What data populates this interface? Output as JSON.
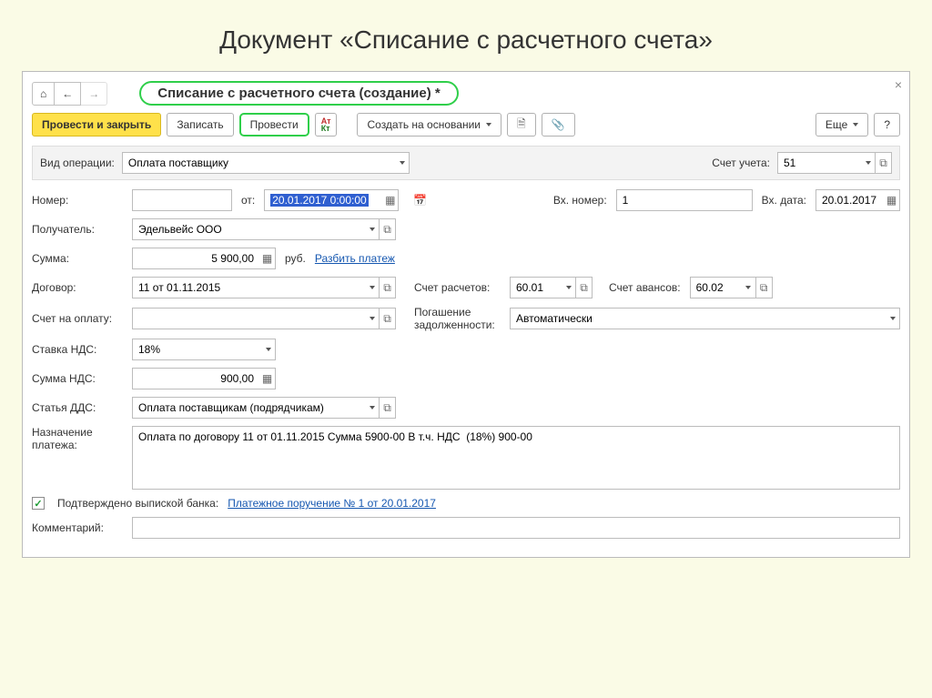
{
  "page_heading": "Документ «Списание с расчетного счета»",
  "doc_title": "Списание с расчетного счета (создание) *",
  "toolbar": {
    "post_close": "Провести и закрыть",
    "save": "Записать",
    "post": "Провести",
    "create_based": "Создать на основании",
    "more": "Еще",
    "help": "?"
  },
  "operation": {
    "label": "Вид операции:",
    "value": "Оплата поставщику",
    "account_label": "Счет учета:",
    "account_value": "51"
  },
  "number": {
    "label": "Номер:",
    "value": "",
    "from_label": "от:",
    "date": "20.01.2017  0:00:00"
  },
  "incoming": {
    "num_label": "Вх. номер:",
    "num_value": "1",
    "date_label": "Вх. дата:",
    "date_value": "20.01.2017"
  },
  "recipient": {
    "label": "Получатель:",
    "value": "Эдельвейс ООО"
  },
  "amount": {
    "label": "Сумма:",
    "value": "5 900,00",
    "currency": "руб.",
    "split": "Разбить платеж"
  },
  "contract": {
    "label": "Договор:",
    "value": "11 от 01.11.2015"
  },
  "settlement": {
    "label": "Счет расчетов:",
    "value": "60.01",
    "advance_label": "Счет авансов:",
    "advance_value": "60.02"
  },
  "invoice": {
    "label": "Счет на оплату:",
    "value": ""
  },
  "debt": {
    "label1": "Погашение",
    "label2": "задолженности:",
    "value": "Автоматически"
  },
  "vat_rate": {
    "label": "Ставка НДС:",
    "value": "18%"
  },
  "vat_amount": {
    "label": "Сумма НДС:",
    "value": "900,00"
  },
  "dds": {
    "label": "Статья ДДС:",
    "value": "Оплата поставщикам (подрядчикам)"
  },
  "purpose": {
    "label1": "Назначение",
    "label2": "платежа:",
    "value": "Оплата по договору 11 от 01.11.2015 Сумма 5900-00 В т.ч. НДС  (18%) 900-00"
  },
  "confirmed": {
    "label": "Подтверждено выпиской банка:",
    "link": "Платежное поручение № 1 от 20.01.2017"
  },
  "comment": {
    "label": "Комментарий:",
    "value": ""
  },
  "glyphs": {
    "home": "⌂",
    "back": "←",
    "fwd": "→",
    "doc": "🗎",
    "clip": "📎",
    "calc": "▦",
    "ext": "⧉",
    "cal": "📅",
    "list": "≣"
  }
}
